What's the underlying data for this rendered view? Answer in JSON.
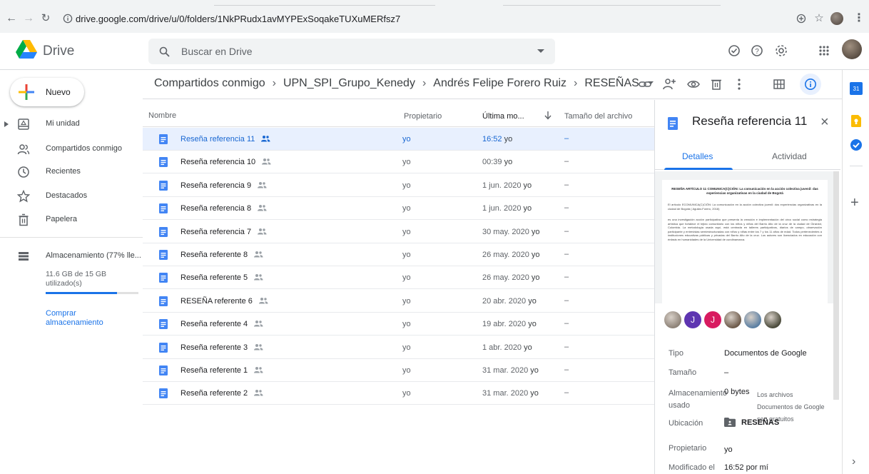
{
  "browser": {
    "url": "drive.google.com/drive/u/0/folders/1NkPRudx1avMYPExSoqakeTUXuMERfsz7"
  },
  "app": {
    "title": "Drive",
    "search_placeholder": "Buscar en Drive"
  },
  "sidebar": {
    "new_label": "Nuevo",
    "items": [
      {
        "label": "Mi unidad",
        "icon": "drive-icon"
      },
      {
        "label": "Compartidos conmigo",
        "icon": "shared-icon"
      },
      {
        "label": "Recientes",
        "icon": "clock-icon"
      },
      {
        "label": "Destacados",
        "icon": "star-icon"
      },
      {
        "label": "Papelera",
        "icon": "trash-icon"
      },
      {
        "label": "Almacenamiento (77% lle...",
        "icon": "storage-icon"
      }
    ],
    "storage_text": "11.6 GB de 15 GB utilizado(s)",
    "storage_fraction": 0.77,
    "buy_storage": "Comprar almacenamiento"
  },
  "breadcrumb": [
    "Compartidos conmigo",
    "UPN_SPI_Grupo_Kenedy",
    "Andrés Felipe Forero Ruiz",
    "RESEÑAS"
  ],
  "columns": {
    "name": "Nombre",
    "owner": "Propietario",
    "modified": "Última mo...",
    "size": "Tamaño del archivo"
  },
  "files": [
    {
      "name": "Reseña referencia 11",
      "owner": "yo",
      "date": "16:52",
      "by": "yo",
      "size": "–"
    },
    {
      "name": "Reseña referencia 10",
      "owner": "yo",
      "date": "00:39",
      "by": "yo",
      "size": "–"
    },
    {
      "name": "Reseña referencia 9",
      "owner": "yo",
      "date": "1 jun. 2020",
      "by": "yo",
      "size": "–"
    },
    {
      "name": "Reseña referencia 8",
      "owner": "yo",
      "date": "1 jun. 2020",
      "by": "yo",
      "size": "–"
    },
    {
      "name": "Reseña referencia 7",
      "owner": "yo",
      "date": "30 may. 2020",
      "by": "yo",
      "size": "–"
    },
    {
      "name": "Reseña referente 8",
      "owner": "yo",
      "date": "26 may. 2020",
      "by": "yo",
      "size": "–"
    },
    {
      "name": "Reseña referente 5",
      "owner": "yo",
      "date": "26 may. 2020",
      "by": "yo",
      "size": "–"
    },
    {
      "name": "RESEÑA referente 6",
      "owner": "yo",
      "date": "20 abr. 2020",
      "by": "yo",
      "size": "–"
    },
    {
      "name": "Reseña referente 4",
      "owner": "yo",
      "date": "19 abr. 2020",
      "by": "yo",
      "size": "–"
    },
    {
      "name": "Reseña referente 3",
      "owner": "yo",
      "date": "1 abr. 2020",
      "by": "yo",
      "size": "–"
    },
    {
      "name": "Reseña referente 1",
      "owner": "yo",
      "date": "31 mar. 2020",
      "by": "yo",
      "size": "–"
    },
    {
      "name": "Reseña referente 2",
      "owner": "yo",
      "date": "31 mar. 2020",
      "by": "yo",
      "size": "–"
    }
  ],
  "details": {
    "title": "Reseña referencia 11",
    "tab_details": "Detalles",
    "tab_activity": "Actividad",
    "preview": {
      "heading": "RESEÑA ARTÍCULO 11 COMUNICA(C)CIÓN: La comunicación en la acción colectiva juvenil: das experiencias organizativas en la ciudad de Bogotá",
      "para1": "El artículo ECOMUNICA(C)CIÓN: La comunicación en la acción colectiva juvenil: dos experiencias organizativas en la ciudad de Bogotá ( Aguilar-Forero, 2016)",
      "para2": "es una investigación acción participativa que presenta la creación e implementación del circo social como estrategia artística que fortalece el tejido comunitario con los niños y niñas del Barrio Alto de la cruz de la ciudad de Girardot, Colombia. La metodología usada aquí, está centrada en talleres participativos, diarios de campo, observación participante y entrevistas semiestructuradas con niños y niñas entre los 7 y los 11 años de edad. Todos pertenecientes a instituciones educativas públicas y privadas del Barrio Alto de la cruz. Los autores son licenciados en educación con énfasis en humanidades de la Universidad de cundinamarca."
    },
    "avatars": [
      {
        "type": "photo",
        "color": "#8d8277"
      },
      {
        "type": "letter",
        "letter": "J",
        "color": "#5e35b1"
      },
      {
        "type": "letter",
        "letter": "J",
        "color": "#d81b60"
      },
      {
        "type": "photo",
        "color": "#6d5a4a"
      },
      {
        "type": "photo",
        "color": "#5b7fa3"
      },
      {
        "type": "photo",
        "color": "#4a4a3a"
      }
    ],
    "type_label": "Tipo",
    "type_value": "Documentos de Google",
    "size_label": "Tamaño",
    "size_value": "–",
    "storage_label": "Almacenamiento usado",
    "storage_value": "0 bytes",
    "storage_note": "Los archivos Documentos de Google son gratuitos",
    "location_label": "Ubicación",
    "location_value": "RESEÑAS",
    "owner_label": "Propietario",
    "owner_value": "yo",
    "modified_label": "Modificado el",
    "modified_value": "16:52 por mí"
  },
  "colors": {
    "accent": "#1a73e8",
    "doc_blue": "#4285f4",
    "selected_row": "#e8f0fe"
  }
}
